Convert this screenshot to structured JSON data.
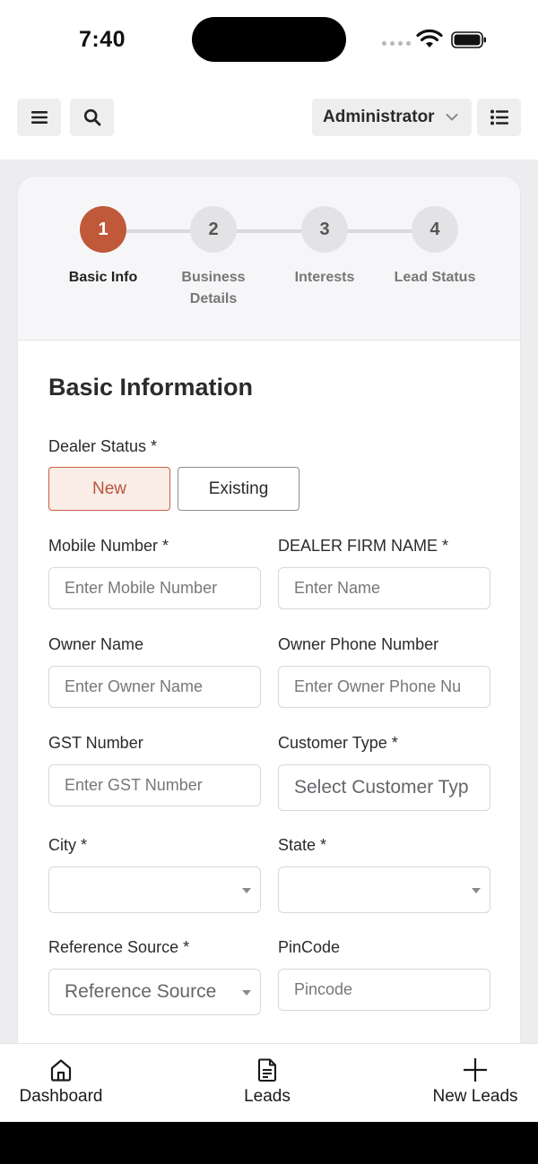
{
  "status_bar": {
    "time": "7:40"
  },
  "header": {
    "user_label": "Administrator"
  },
  "stepper": {
    "steps": [
      {
        "number": "1",
        "label": "Basic Info"
      },
      {
        "number": "2",
        "label": "Business Details"
      },
      {
        "number": "3",
        "label": "Interests"
      },
      {
        "number": "4",
        "label": "Lead Status"
      }
    ]
  },
  "form": {
    "title": "Basic Information",
    "dealer_status": {
      "label": "Dealer Status *",
      "options": [
        "New",
        "Existing"
      ],
      "selected": "New"
    },
    "mobile_number": {
      "label": "Mobile Number *",
      "placeholder": "Enter Mobile Number"
    },
    "dealer_firm_name": {
      "label": "DEALER FIRM NAME *",
      "placeholder": "Enter Name"
    },
    "owner_name": {
      "label": "Owner Name",
      "placeholder": "Enter Owner Name"
    },
    "owner_phone": {
      "label": "Owner Phone Number",
      "placeholder": "Enter Owner Phone Nu"
    },
    "gst_number": {
      "label": "GST Number",
      "placeholder": "Enter GST Number"
    },
    "customer_type": {
      "label": "Customer Type *",
      "placeholder": "Select Customer Typ"
    },
    "city": {
      "label": "City *",
      "value": ""
    },
    "state": {
      "label": "State *",
      "value": ""
    },
    "reference_source": {
      "label": "Reference Source *",
      "placeholder": "Reference Source"
    },
    "pincode": {
      "label": "PinCode",
      "placeholder": "Pincode"
    }
  },
  "bottom_nav": {
    "items": [
      {
        "label": "Dashboard",
        "icon": "home-icon"
      },
      {
        "label": "Leads",
        "icon": "document-icon"
      },
      {
        "label": "New Leads",
        "icon": "plus-icon"
      }
    ]
  }
}
